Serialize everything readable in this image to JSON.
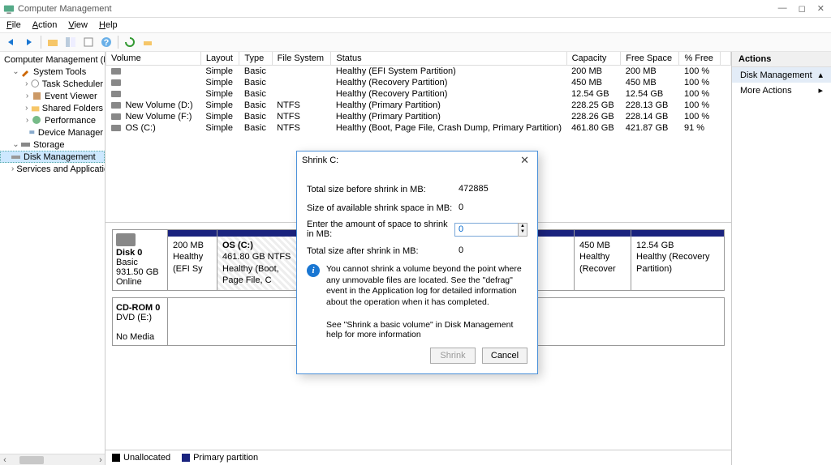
{
  "window": {
    "title": "Computer Management"
  },
  "menu": {
    "file": "File",
    "action": "Action",
    "view": "View",
    "help": "Help"
  },
  "tree": {
    "root": "Computer Management (Local)",
    "system_tools": "System Tools",
    "task_scheduler": "Task Scheduler",
    "event_viewer": "Event Viewer",
    "shared_folders": "Shared Folders",
    "performance": "Performance",
    "device_manager": "Device Manager",
    "storage": "Storage",
    "disk_management": "Disk Management",
    "services_apps": "Services and Applications"
  },
  "cols": {
    "volume": "Volume",
    "layout": "Layout",
    "type": "Type",
    "fs": "File System",
    "status": "Status",
    "capacity": "Capacity",
    "free": "Free Space",
    "pctfree": "% Free"
  },
  "volumes": [
    {
      "name": "",
      "layout": "Simple",
      "type": "Basic",
      "fs": "",
      "status": "Healthy (EFI System Partition)",
      "cap": "200 MB",
      "free": "200 MB",
      "pct": "100 %"
    },
    {
      "name": "",
      "layout": "Simple",
      "type": "Basic",
      "fs": "",
      "status": "Healthy (Recovery Partition)",
      "cap": "450 MB",
      "free": "450 MB",
      "pct": "100 %"
    },
    {
      "name": "",
      "layout": "Simple",
      "type": "Basic",
      "fs": "",
      "status": "Healthy (Recovery Partition)",
      "cap": "12.54 GB",
      "free": "12.54 GB",
      "pct": "100 %"
    },
    {
      "name": "New Volume (D:)",
      "layout": "Simple",
      "type": "Basic",
      "fs": "NTFS",
      "status": "Healthy (Primary Partition)",
      "cap": "228.25 GB",
      "free": "228.13 GB",
      "pct": "100 %"
    },
    {
      "name": "New Volume (F:)",
      "layout": "Simple",
      "type": "Basic",
      "fs": "NTFS",
      "status": "Healthy (Primary Partition)",
      "cap": "228.26 GB",
      "free": "228.14 GB",
      "pct": "100 %"
    },
    {
      "name": "OS (C:)",
      "layout": "Simple",
      "type": "Basic",
      "fs": "NTFS",
      "status": "Healthy (Boot, Page File, Crash Dump, Primary Partition)",
      "cap": "461.80 GB",
      "free": "421.87 GB",
      "pct": "91 %"
    }
  ],
  "disk0": {
    "name": "Disk 0",
    "type": "Basic",
    "size": "931.50 GB",
    "state": "Online",
    "parts": [
      {
        "l1": "200 MB",
        "l2": "Healthy (EFI Sy"
      },
      {
        "l1": "OS  (C:)",
        "l2": "461.80 GB NTFS",
        "l3": "Healthy (Boot, Page File, C"
      },
      {
        "l1": "450 MB",
        "l2": "Healthy (Recover"
      },
      {
        "l1": "12.54 GB",
        "l2": "Healthy (Recovery Partition)"
      }
    ]
  },
  "cdrom": {
    "name": "CD-ROM 0",
    "drive": "DVD (E:)",
    "nomedia": "No Media"
  },
  "legend": {
    "unalloc": "Unallocated",
    "primary": "Primary partition"
  },
  "actions": {
    "header": "Actions",
    "dm": "Disk Management",
    "more": "More Actions"
  },
  "dialog": {
    "title": "Shrink C:",
    "total_before_lbl": "Total size before shrink in MB:",
    "total_before": "472885",
    "avail_lbl": "Size of available shrink space in MB:",
    "avail": "0",
    "enter_lbl": "Enter the amount of space to shrink in MB:",
    "enter": "0",
    "total_after_lbl": "Total size after shrink in MB:",
    "total_after": "0",
    "info": "You cannot shrink a volume beyond the point where any unmovable files are located. See the \"defrag\" event in the Application log for detailed information about the operation when it has completed.",
    "help": "See \"Shrink a basic volume\" in Disk Management help for more information",
    "shrink": "Shrink",
    "cancel": "Cancel"
  }
}
